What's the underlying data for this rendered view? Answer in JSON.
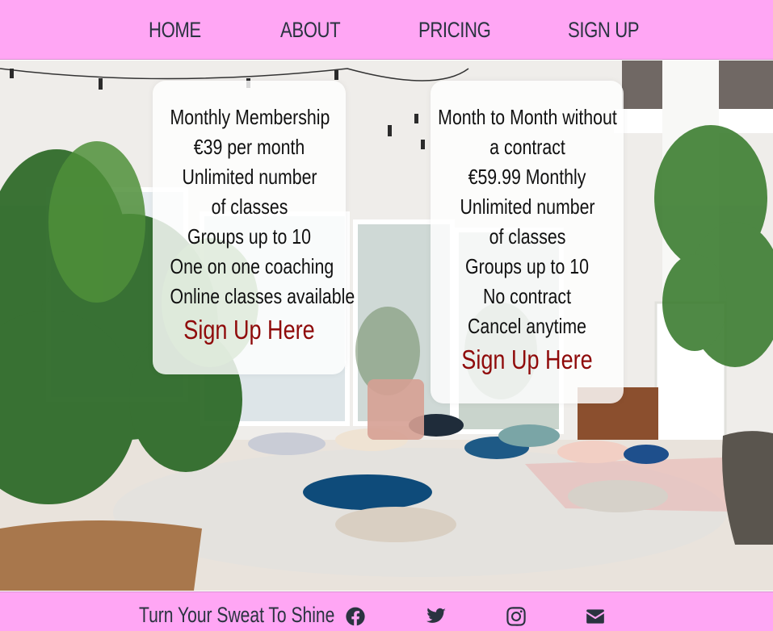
{
  "nav": {
    "items": [
      {
        "label": "HOME"
      },
      {
        "label": "ABOUT"
      },
      {
        "label": "PRICING"
      },
      {
        "label": "SIGN UP"
      }
    ]
  },
  "pricing": {
    "cards": [
      {
        "lines": [
          "Monthly Membership",
          "€39 per month",
          "Unlimited number of classes",
          "Groups up to 10",
          "One on one coaching",
          "Online classes available"
        ],
        "cta": "Sign Up Here"
      },
      {
        "lines": [
          "Month to Month without a contract",
          "€59.99 Monthly",
          "Unlimited number of classes",
          "Groups up to 10",
          "No contract",
          "Cancel anytime"
        ],
        "cta": "Sign Up Here"
      }
    ]
  },
  "footer": {
    "tagline": "Turn Your Sweat To Shine",
    "social": [
      {
        "icon": "facebook-icon"
      },
      {
        "icon": "twitter-icon"
      },
      {
        "icon": "instagram-icon"
      },
      {
        "icon": "envelope-icon"
      }
    ]
  },
  "colors": {
    "nav_bg": "#ffa6f4",
    "text": "#2a3340",
    "cta": "#8f0a0a",
    "card_bg": "#ffffff"
  }
}
